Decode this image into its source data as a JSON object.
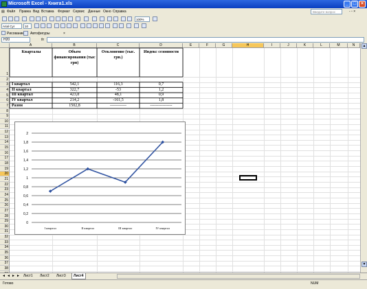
{
  "window": {
    "title": "Microsoft Excel - Книга1.xls"
  },
  "menu": {
    "items": [
      "Файл",
      "Правка",
      "Вид",
      "Вставка",
      "Формат",
      "Сервис",
      "Данные",
      "Окно",
      "Справка"
    ],
    "ask_placeholder": "Введите вопрос"
  },
  "format_bar": {
    "font": "Arial Cyr",
    "size": "10",
    "zoom": "100%"
  },
  "draw_bar": {
    "draw_label": "Рисование",
    "autoshapes_label": "Автофигуры"
  },
  "formula_bar": {
    "name_box": "H20",
    "fx": "fx",
    "content": ""
  },
  "columns": [
    "A",
    "B",
    "C",
    "D",
    "E",
    "F",
    "G",
    "H",
    "I",
    "J",
    "K",
    "L",
    "M",
    "N"
  ],
  "active_cell": {
    "column": "H",
    "row": 20
  },
  "table": {
    "headers": [
      "Кварталы",
      "Объем финансирования (тыс грн)",
      "Отклонение (тыс. грн.)",
      "Индекс сезонности"
    ],
    "rows": [
      [
        "I квартал",
        "542,1",
        "116,3",
        "0,7"
      ],
      [
        "II квартал",
        "322,7",
        "-53",
        "1,2"
      ],
      [
        "III квартал",
        "423,8",
        "48,1",
        "0,9"
      ],
      [
        "IV квартал",
        "214,2",
        "-161,5",
        "1,8"
      ],
      [
        "Разом",
        "1502,8",
        "------------",
        "----------------"
      ]
    ]
  },
  "chart_data": {
    "type": "line",
    "categories": [
      "I квартал",
      "II квартал",
      "III квартал",
      "IV квартал"
    ],
    "series": [
      {
        "values": [
          0.7,
          1.2,
          0.9,
          1.8
        ]
      }
    ],
    "ylim": [
      0,
      2
    ],
    "yticks": [
      "0",
      "0,2",
      "0,4",
      "0,6",
      "0,8",
      "1",
      "1,2",
      "1,4",
      "1,6",
      "1,8",
      "2"
    ],
    "line_color": "#2f52a0",
    "grid": true,
    "legend": "none"
  },
  "sheets": [
    "Лист1",
    "Лист2",
    "Лист3",
    "Лист4"
  ],
  "active_sheet": "Лист4",
  "status": {
    "text": "Готово",
    "mode": "NUM"
  }
}
